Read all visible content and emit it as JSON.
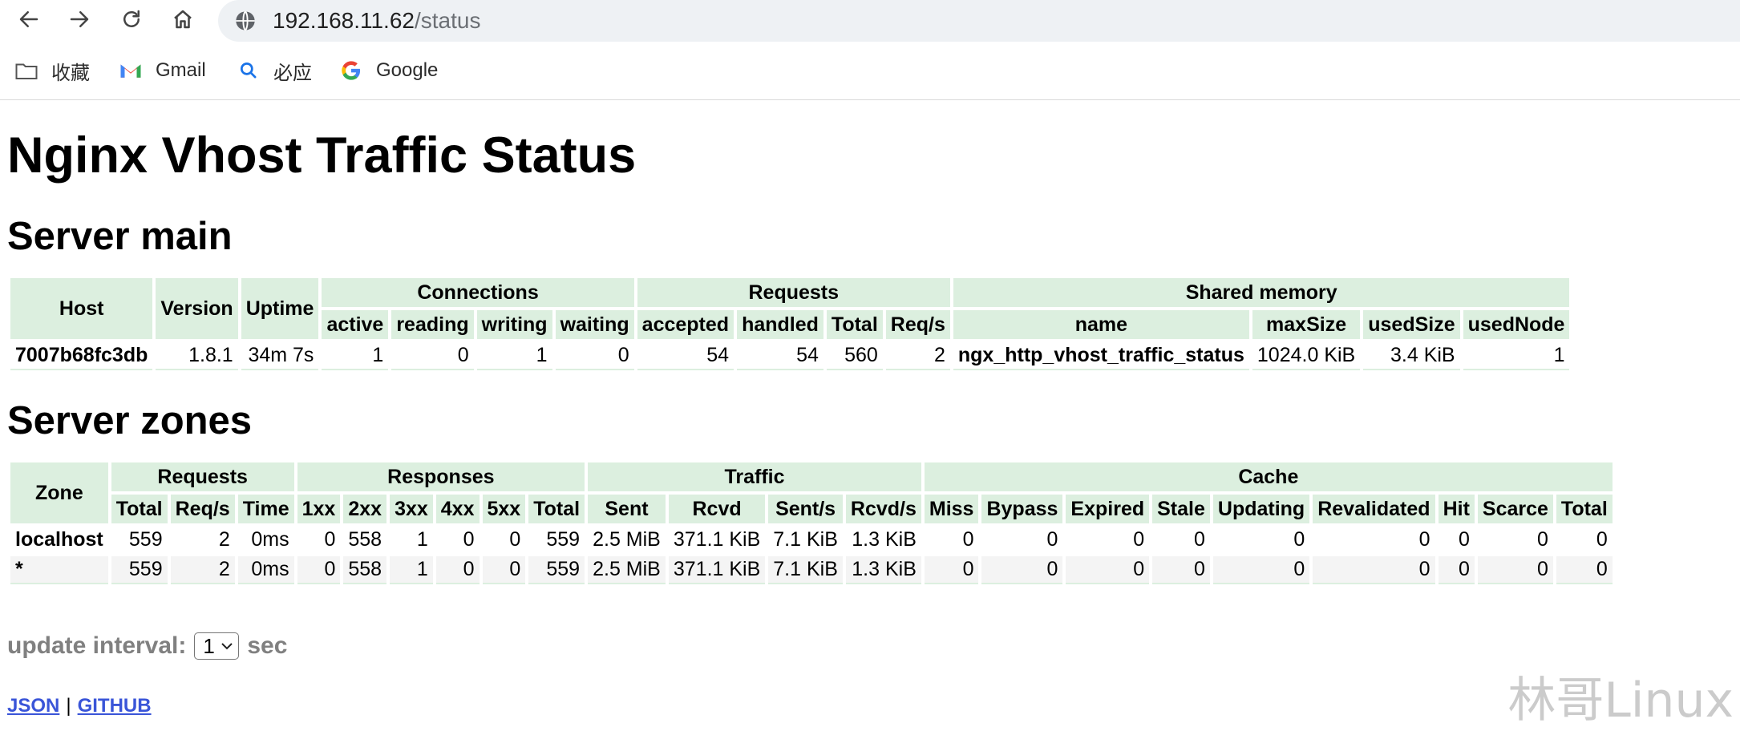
{
  "browser": {
    "url_host": "192.168.11.62",
    "url_path": "/status",
    "bookmarks": [
      {
        "icon": "folder-icon",
        "label": "收藏"
      },
      {
        "icon": "gmail-icon",
        "label": "Gmail"
      },
      {
        "icon": "bing-search-icon",
        "label": "必应"
      },
      {
        "icon": "google-icon",
        "label": "Google"
      }
    ]
  },
  "page": {
    "title": "Nginx Vhost Traffic Status",
    "server_main_heading": "Server main",
    "server_zones_heading": "Server zones"
  },
  "server_main": {
    "group_headers": {
      "host": "Host",
      "version": "Version",
      "uptime": "Uptime",
      "connections": "Connections",
      "requests": "Requests",
      "shared_memory": "Shared memory"
    },
    "sub_headers": [
      "active",
      "reading",
      "writing",
      "waiting",
      "accepted",
      "handled",
      "Total",
      "Req/s",
      "name",
      "maxSize",
      "usedSize",
      "usedNode"
    ],
    "row": [
      "7007b68fc3db",
      "1.8.1",
      "34m 7s",
      "1",
      "0",
      "1",
      "0",
      "54",
      "54",
      "560",
      "2",
      "ngx_http_vhost_traffic_status",
      "1024.0 KiB",
      "3.4 KiB",
      "1"
    ]
  },
  "server_zones": {
    "group_headers": {
      "zone": "Zone",
      "requests": "Requests",
      "responses": "Responses",
      "traffic": "Traffic",
      "cache": "Cache"
    },
    "sub_headers": [
      "Total",
      "Req/s",
      "Time",
      "1xx",
      "2xx",
      "3xx",
      "4xx",
      "5xx",
      "Total",
      "Sent",
      "Rcvd",
      "Sent/s",
      "Rcvd/s",
      "Miss",
      "Bypass",
      "Expired",
      "Stale",
      "Updating",
      "Revalidated",
      "Hit",
      "Scarce",
      "Total"
    ],
    "rows": [
      [
        "localhost",
        "559",
        "2",
        "0ms",
        "0",
        "558",
        "1",
        "0",
        "0",
        "559",
        "2.5 MiB",
        "371.1 KiB",
        "7.1 KiB",
        "1.3 KiB",
        "0",
        "0",
        "0",
        "0",
        "0",
        "0",
        "0",
        "0",
        "0"
      ],
      [
        "*",
        "559",
        "2",
        "0ms",
        "0",
        "558",
        "1",
        "0",
        "0",
        "559",
        "2.5 MiB",
        "371.1 KiB",
        "7.1 KiB",
        "1.3 KiB",
        "0",
        "0",
        "0",
        "0",
        "0",
        "0",
        "0",
        "0",
        "0"
      ]
    ]
  },
  "footer": {
    "interval_label": "update interval:",
    "interval_value": "1",
    "interval_unit": "sec",
    "json_link": "JSON",
    "separator": "|",
    "github_link": "GITHUB"
  },
  "watermark": "林哥Linux"
}
